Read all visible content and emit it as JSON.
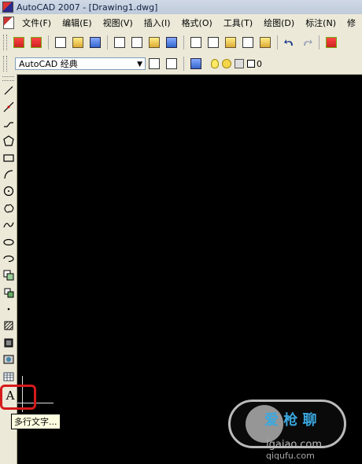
{
  "window": {
    "title": "AutoCAD 2007 - [Drawing1.dwg]"
  },
  "menubar": {
    "items": [
      "文件(F)",
      "编辑(E)",
      "视图(V)",
      "插入(I)",
      "格式(O)",
      "工具(T)",
      "绘图(D)",
      "标注(N)",
      "修"
    ]
  },
  "workspace": {
    "selected": "AutoCAD 经典"
  },
  "layer": {
    "current": "0"
  },
  "left_toolbar": {
    "tools": [
      "line-icon",
      "construction-line-icon",
      "polyline-icon",
      "polygon-icon",
      "rectangle-icon",
      "arc-icon",
      "circle-icon",
      "revision-cloud-icon",
      "spline-icon",
      "ellipse-icon",
      "ellipse-arc-icon",
      "insert-block-icon",
      "make-block-icon",
      "point-icon",
      "hatch-icon",
      "gradient-icon",
      "region-icon",
      "table-icon"
    ],
    "text_tool_label": "A"
  },
  "tooltip": {
    "text": "多行文字..."
  },
  "watermark": {
    "line1": "爱 枪 聊",
    "line2": "igaiao.com",
    "line3": "qiqufu.com"
  },
  "colors": {
    "canvas": "#000000",
    "highlight": "#d61b1b"
  }
}
